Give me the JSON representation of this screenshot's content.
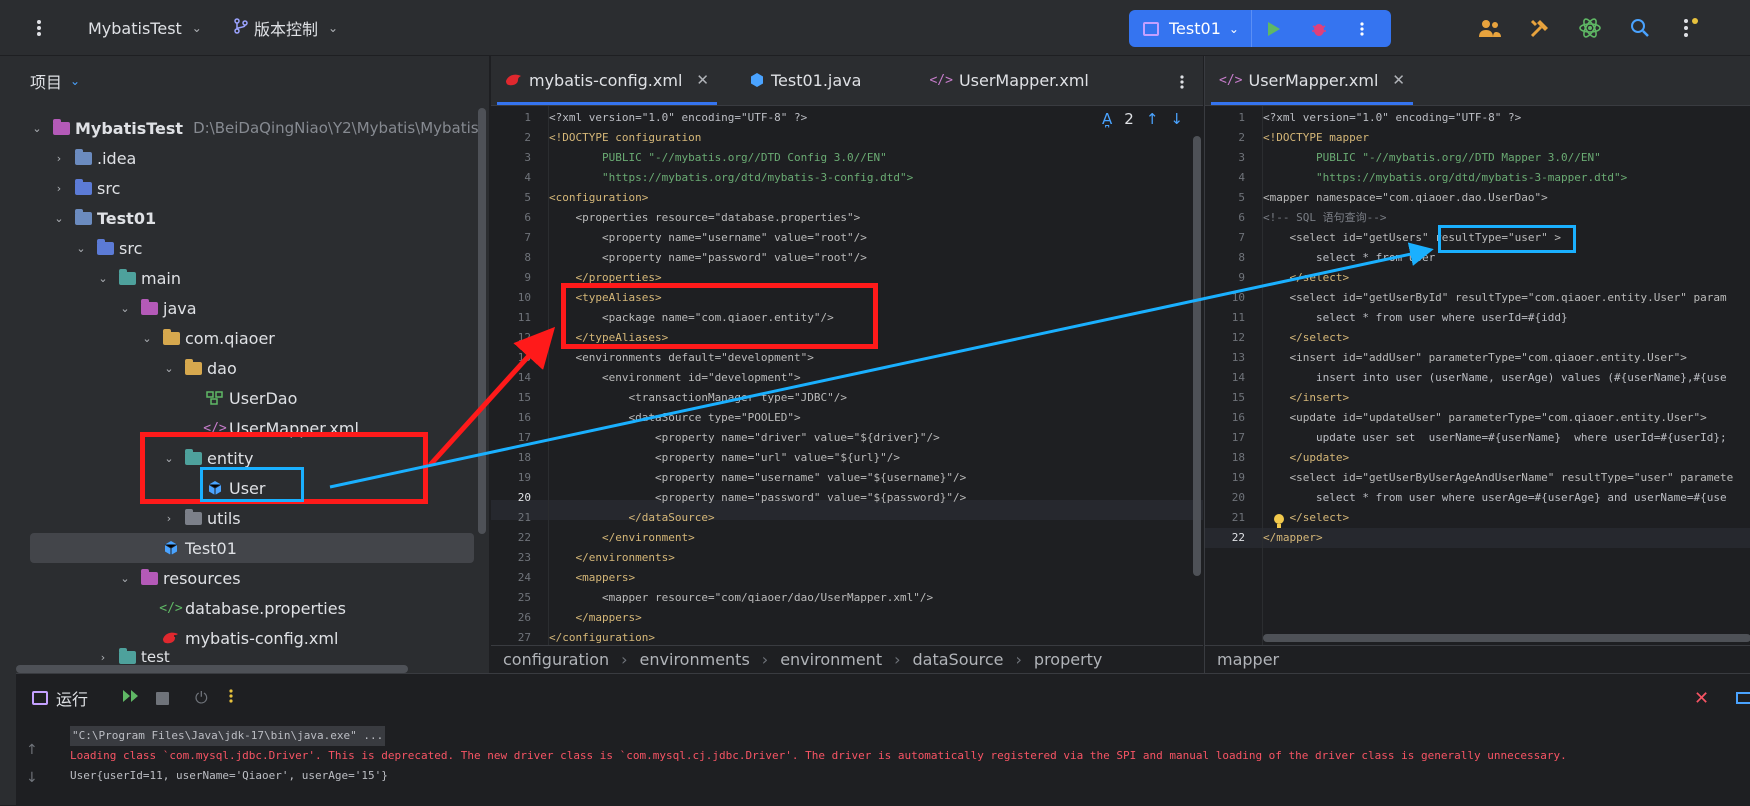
{
  "titlebar": {
    "project_name": "MybatisTest",
    "vcs_label": "版本控制",
    "run_config": "Test01"
  },
  "project_panel": {
    "title": "项目",
    "tree": [
      {
        "label": "MybatisTest",
        "path": "D:\\BeiDaQingNiao\\Y2\\Mybatis\\Mybatis"
      },
      {
        "label": ".idea"
      },
      {
        "label": "src"
      },
      {
        "label": "Test01"
      },
      {
        "label": "src"
      },
      {
        "label": "main"
      },
      {
        "label": "java"
      },
      {
        "label": "com.qiaoer"
      },
      {
        "label": "dao"
      },
      {
        "label": "UserDao"
      },
      {
        "label": "UserMapper.xml"
      },
      {
        "label": "entity"
      },
      {
        "label": "User"
      },
      {
        "label": "utils"
      },
      {
        "label": "Test01"
      },
      {
        "label": "resources"
      },
      {
        "label": "database.properties"
      },
      {
        "label": "mybatis-config.xml"
      },
      {
        "label": "test"
      }
    ]
  },
  "editor_left": {
    "tabs": [
      "mybatis-config.xml",
      "Test01.java",
      "UserMapper.xml"
    ],
    "inspection_count": "2",
    "breadcrumb": [
      "configuration",
      "environments",
      "environment",
      "dataSource",
      "property"
    ],
    "lines": [
      "<?xml version=\"1.0\" encoding=\"UTF-8\" ?>",
      "<!DOCTYPE configuration",
      "        PUBLIC \"-//mybatis.org//DTD Config 3.0//EN\"",
      "        \"https://mybatis.org/dtd/mybatis-3-config.dtd\">",
      "<configuration>",
      "    <properties resource=\"database.properties\">",
      "        <property name=\"username\" value=\"root\"/>",
      "        <property name=\"password\" value=\"root\"/>",
      "    </properties>",
      "    <typeAliases>",
      "        <package name=\"com.qiaoer.entity\"/>",
      "    </typeAliases>",
      "    <environments default=\"development\">",
      "        <environment id=\"development\">",
      "            <transactionManager type=\"JDBC\"/>",
      "            <dataSource type=\"POOLED\">",
      "                <property name=\"driver\" value=\"${driver}\"/>",
      "                <property name=\"url\" value=\"${url}\"/>",
      "                <property name=\"username\" value=\"${username}\"/>",
      "                <property name=\"password\" value=\"${password}\"/>",
      "            </dataSource>",
      "        </environment>",
      "    </environments>",
      "    <mappers>",
      "        <mapper resource=\"com/qiaoer/dao/UserMapper.xml\"/>",
      "    </mappers>",
      "</configuration>"
    ]
  },
  "editor_right": {
    "tabs": [
      "UserMapper.xml"
    ],
    "breadcrumb": [
      "mapper"
    ],
    "lines": [
      "<?xml version=\"1.0\" encoding=\"UTF-8\" ?>",
      "<!DOCTYPE mapper",
      "        PUBLIC \"-//mybatis.org//DTD Mapper 3.0//EN\"",
      "        \"https://mybatis.org/dtd/mybatis-3-mapper.dtd\">",
      "<mapper namespace=\"com.qiaoer.dao.UserDao\">",
      "<!-- SQL 语句查询-->",
      "    <select id=\"getUsers\" resultType=\"user\" >",
      "        select * from user",
      "    </select>",
      "    <select id=\"getUserById\" resultType=\"com.qiaoer.entity.User\" param",
      "        select * from user where userId=#{idd}",
      "    </select>",
      "    <insert id=\"addUser\" parameterType=\"com.qiaoer.entity.User\">",
      "        insert into user (userName, userAge) values (#{userName},#{use",
      "    </insert>",
      "    <update id=\"updateUser\" parameterType=\"com.qiaoer.entity.User\">",
      "        update user set  userName=#{userName}  where userId=#{userId};",
      "    </update>",
      "    <select id=\"getUserByUserAgeAndUserName\" resultType=\"user\" paramete",
      "        select * from user where userAge=#{userAge} and userName=#{use",
      "    </select>",
      "</mapper>"
    ]
  },
  "run_panel": {
    "title": "运行",
    "console": [
      "\"C:\\Program Files\\Java\\jdk-17\\bin\\java.exe\" ...",
      "Loading class `com.mysql.jdbc.Driver'. This is deprecated. The new driver class is `com.mysql.cj.jdbc.Driver'. The driver is automatically registered via the SPI and manual loading of the driver class is generally unnecessary.",
      "User{userId=11, userName='Qiaoer', userAge='15'}"
    ]
  },
  "colors": {
    "accent": "#3574f0",
    "annotation_red": "#ff1a1a",
    "annotation_blue": "#1ab0ff"
  }
}
